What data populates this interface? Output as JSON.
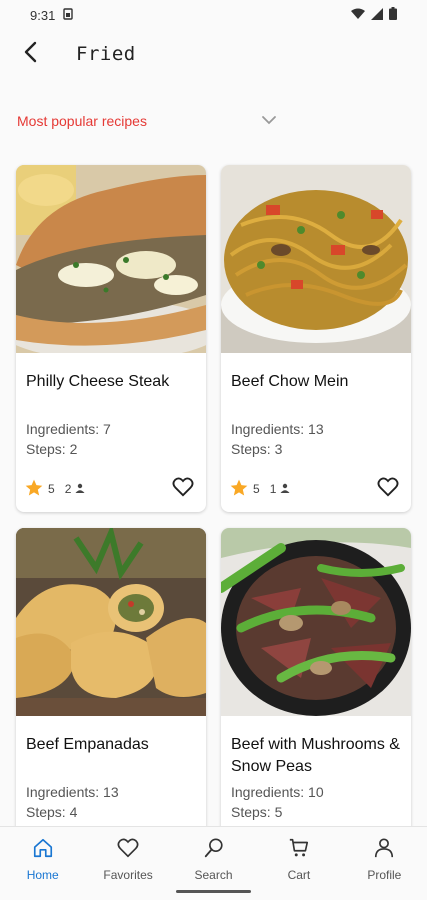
{
  "status_bar": {
    "time": "9:31",
    "notification_icon": "sim-card-icon",
    "icons": [
      "wifi-icon",
      "signal-icon",
      "battery-icon"
    ]
  },
  "header": {
    "title": "Fried",
    "back_icon": "arrow-left-icon"
  },
  "sort": {
    "label": "Most popular recipes",
    "icon": "chevron-down-icon",
    "accent": "#e53935"
  },
  "recipes": [
    {
      "title": "Philly Cheese Steak",
      "ingredients": "Ingredients: 7",
      "steps": "Steps: 2",
      "rating": "5",
      "reviews": "2",
      "image": "sandwich"
    },
    {
      "title": "Beef Chow Mein",
      "ingredients": "Ingredients: 13",
      "steps": "Steps: 3",
      "rating": "5",
      "reviews": "1",
      "image": "noodles"
    },
    {
      "title": "Beef Empanadas",
      "ingredients": "Ingredients: 13",
      "steps": "Steps: 4",
      "rating": "",
      "reviews": "",
      "image": "empanadas"
    },
    {
      "title": "Beef with Mushrooms & Snow Peas",
      "ingredients": "Ingredients: 10",
      "steps": "Steps: 5",
      "rating": "",
      "reviews": "",
      "image": "stirfry"
    }
  ],
  "bottom_nav": [
    {
      "label": "Home",
      "icon": "home-icon",
      "active": true
    },
    {
      "label": "Favorites",
      "icon": "heart-icon",
      "active": false
    },
    {
      "label": "Search",
      "icon": "search-icon",
      "active": false
    },
    {
      "label": "Cart",
      "icon": "cart-icon",
      "active": false
    },
    {
      "label": "Profile",
      "icon": "profile-icon",
      "active": false
    }
  ],
  "colors": {
    "accent_active": "#1976d2",
    "star": "#f9a825",
    "sort_text": "#e53935"
  }
}
